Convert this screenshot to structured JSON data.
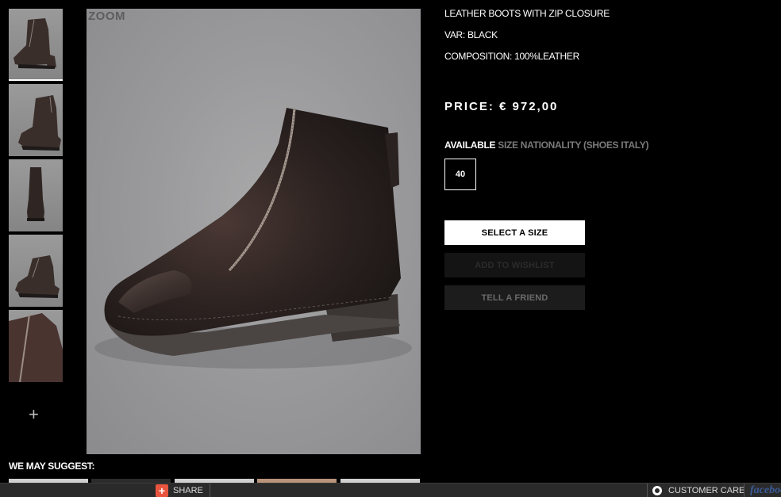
{
  "product": {
    "name": "LEATHER BOOTS WITH ZIP CLOSURE",
    "variant": "VAR: BLACK",
    "composition": "COMPOSITION: 100%LEATHER",
    "price": "PRICE: € 972,00",
    "availability_label": "AVAILABLE",
    "availability_note": "SIZE NATIONALITY (SHOES ITALY)",
    "sizes": [
      "40"
    ]
  },
  "gallery": {
    "zoom_label": "ZOOM",
    "more_label": "+",
    "thumbnail_count": 5,
    "active_index": 0
  },
  "actions": {
    "select_size": "SELECT A SIZE",
    "add_to_wishlist": "ADD TO WISHLIST",
    "tell_friend": "TELL A FRIEND"
  },
  "suggestions": {
    "heading": "WE MAY SUGGEST:"
  },
  "bottom_bar": {
    "share_icon": "plus-icon",
    "share_label": "SHARE",
    "customer_care_icon": "chat-icon",
    "customer_care_label": "CUSTOMER CARE",
    "facebook_label": "facebook"
  },
  "colors": {
    "background": "#000000",
    "share_accent": "#e8553f",
    "facebook_blue": "#3b5b98"
  }
}
